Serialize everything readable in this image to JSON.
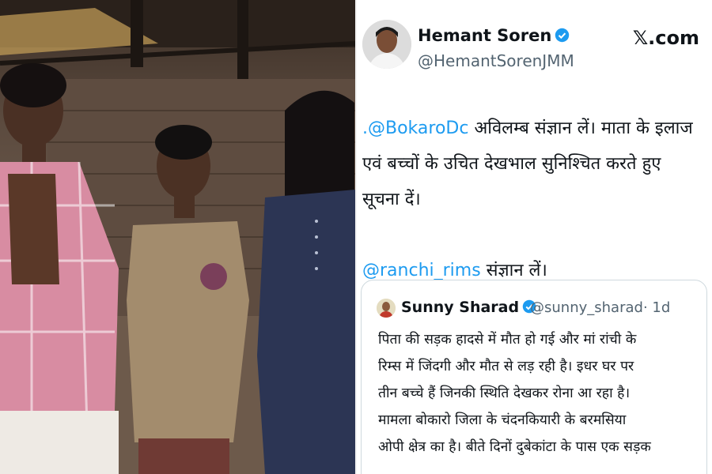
{
  "photo": {
    "alt_description": ""
  },
  "tweet": {
    "author_name": "Hemant Soren",
    "author_handle": "@HemantSorenJMM",
    "site_label": "𝕏.com",
    "body_lines": [
      ".@BokaroDc अविलम्ब संज्ञान लें। माता के इलाज",
      "एवं बच्चों के उचित देखभाल सुनिश्चित करते हुए",
      "सूचना दें।"
    ],
    "mention1": ".@BokaroDc",
    "line1_rest": " अविलम्ब संज्ञान लें। माता के इलाज",
    "line2": "एवं बच्चों के उचित देखभाल सुनिश्चित करते हुए",
    "line3": "सूचना दें।",
    "mention2": "@ranchi_rims",
    "line4_rest": " संज्ञान लें।",
    "quoted": {
      "author_name": "Sunny Sharad",
      "author_handle": "@sunny_sharad",
      "time": "· 1d",
      "lines": [
        "पिता की सड़क हादसे में मौत हो गई और मां रांची के",
        "रिम्स में जिंदगी और मौत से लड़ रही है। इधर घर पर",
        "तीन बच्चे हैं जिनकी स्थिति देखकर रोना आ रहा है।",
        "मामला बोकारो जिला के चंदनकियारी के बरमसिया",
        "ओपी क्षेत्र का है। बीते दिनों दुबेकांटा के पास एक सड़क"
      ]
    }
  },
  "colors": {
    "link": "#1d9bf0",
    "text": "#0f1419",
    "muted": "#536471",
    "border": "#cfd9de"
  }
}
